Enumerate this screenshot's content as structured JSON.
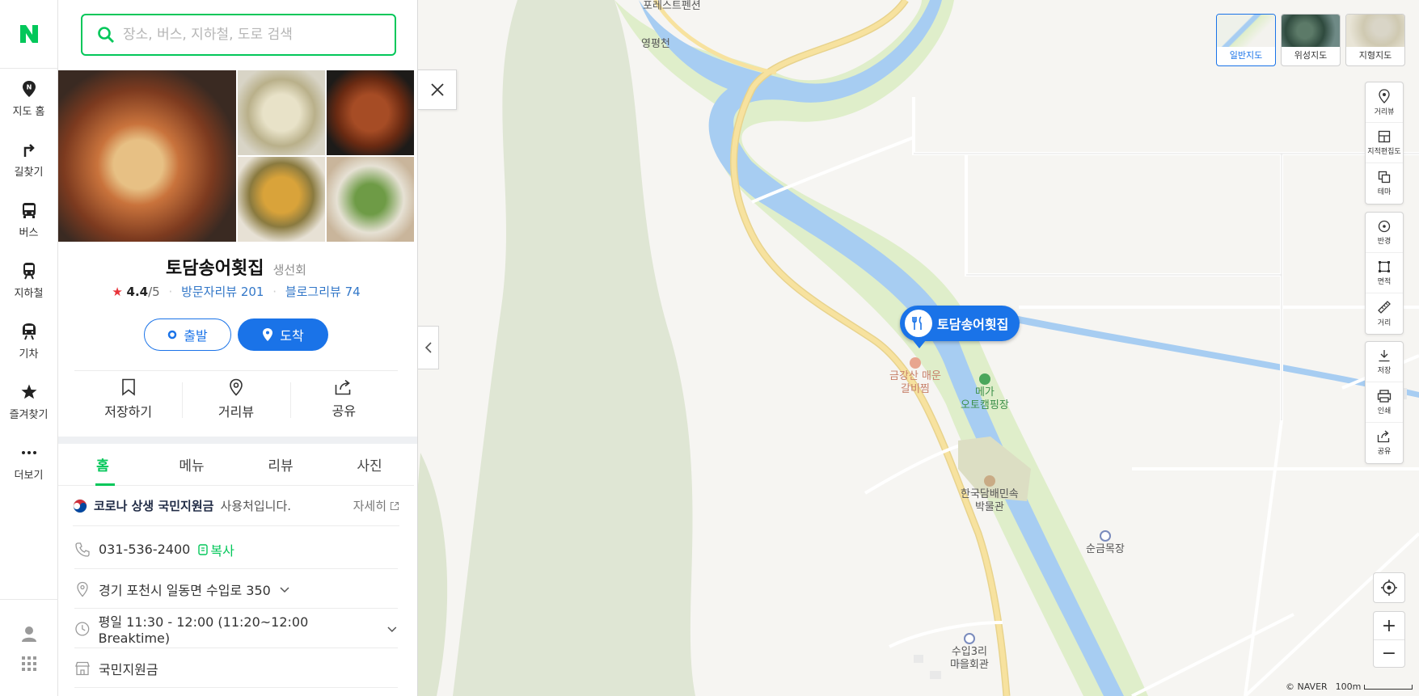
{
  "nav": {
    "items": [
      {
        "label": "지도 홈",
        "icon": "map-home-icon"
      },
      {
        "label": "길찾기",
        "icon": "directions-icon"
      },
      {
        "label": "버스",
        "icon": "bus-icon"
      },
      {
        "label": "지하철",
        "icon": "subway-icon"
      },
      {
        "label": "기차",
        "icon": "train-icon"
      },
      {
        "label": "즐겨찾기",
        "icon": "star-icon"
      },
      {
        "label": "더보기",
        "icon": "more-icon"
      }
    ]
  },
  "search": {
    "placeholder": "장소, 버스, 지하철, 도로 검색"
  },
  "place": {
    "name": "토담송어횟집",
    "category": "생선회",
    "rating": "4.4",
    "rating_max": "/5",
    "visitor_reviews": "방문자리뷰 201",
    "blog_reviews": "블로그리뷰 74",
    "depart_label": "출발",
    "arrive_label": "도착"
  },
  "actions": [
    {
      "label": "저장하기",
      "icon": "bookmark-icon"
    },
    {
      "label": "거리뷰",
      "icon": "pin-icon"
    },
    {
      "label": "공유",
      "icon": "share-icon"
    }
  ],
  "tabs": [
    {
      "label": "홈",
      "active": true
    },
    {
      "label": "메뉴",
      "active": false
    },
    {
      "label": "리뷰",
      "active": false
    },
    {
      "label": "사진",
      "active": false
    }
  ],
  "notice": {
    "bold": "코로나 상생 국민지원금",
    "rest": "사용처입니다.",
    "more": "자세히"
  },
  "info": {
    "phone": "031-536-2400",
    "copy": "복사",
    "address": "경기 포천시 일동면 수입로 350",
    "hours": "평일 11:30 - 12:00 (11:20~12:00 Breaktime)",
    "extra": "국민지원금"
  },
  "map": {
    "labels": {
      "pension": "포레스트펜션",
      "stream": "영평천",
      "restaurant": "금강산 매운\n갈비찜",
      "camping": "메가\n오토캠핑장",
      "museum": "한국담배민속\n박물관",
      "ranch": "순금목장",
      "hall": "수입3리\n마을회관"
    },
    "marker": "토담송어횟집",
    "types": [
      {
        "label": "일반지도",
        "active": true
      },
      {
        "label": "위성지도",
        "active": false
      },
      {
        "label": "지형지도",
        "active": false
      }
    ],
    "tools_group1": [
      "거리뷰",
      "지적편집도",
      "테마"
    ],
    "tools_group2": [
      "반경",
      "면적",
      "거리"
    ],
    "tools_group3": [
      "저장",
      "인쇄",
      "공유"
    ],
    "zoom_in": "+",
    "zoom_out": "−",
    "attribution": "© NAVER",
    "scale": "100m"
  },
  "colors": {
    "brand_green": "#03c75a",
    "accent_blue": "#1a73e8",
    "river": "#a7cdf2",
    "road": "#f7e29f"
  }
}
